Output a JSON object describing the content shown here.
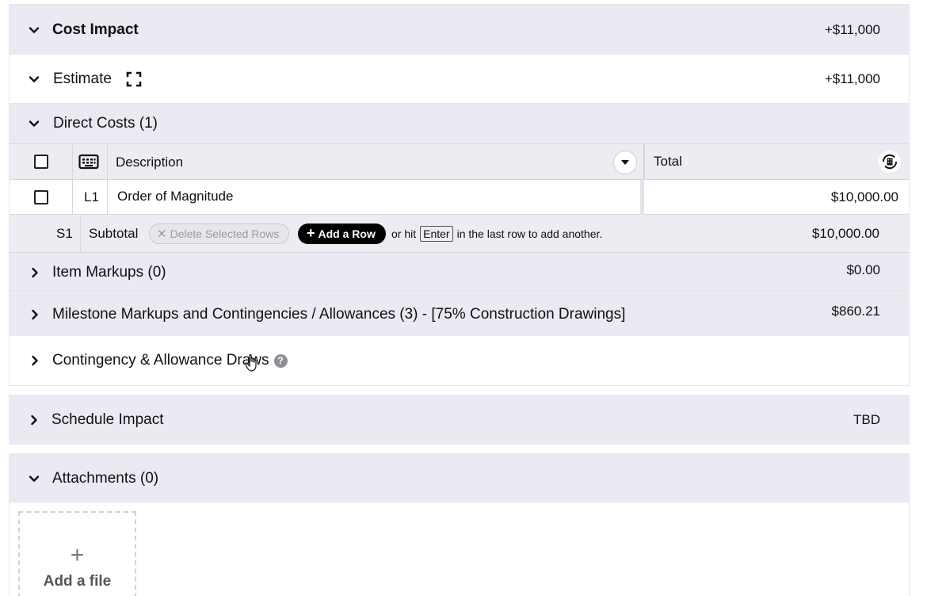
{
  "cost_impact": {
    "title": "Cost Impact",
    "amount": "+$11,000"
  },
  "estimate": {
    "title": "Estimate",
    "amount": "+$11,000"
  },
  "direct_costs": {
    "title": "Direct Costs (1)",
    "columns": {
      "description": "Description",
      "total": "Total"
    },
    "rows": [
      {
        "line": "L1",
        "description": "Order of Magnitude",
        "total": "$10,000.00"
      }
    ],
    "subtotal": {
      "code": "S1",
      "label": "Subtotal",
      "delete_label": "Delete Selected Rows",
      "add_label": "Add a Row",
      "hint_prefix": "or hit",
      "hint_key": "Enter",
      "hint_suffix": "in the last row to add another.",
      "amount": "$10,000.00"
    }
  },
  "item_markups": {
    "title": "Item Markups (0)",
    "amount": "$0.00"
  },
  "milestone_markups": {
    "title": "Milestone Markups and Contingencies / Allowances (3) - [75% Construction Drawings]",
    "amount": "$860.21"
  },
  "contingency_draws": {
    "title": "Contingency & Allowance Draws"
  },
  "schedule_impact": {
    "title": "Schedule Impact",
    "amount": "TBD"
  },
  "attachments": {
    "title": "Attachments (0)",
    "add_file_label": "Add a file"
  },
  "colors": {
    "header_bg": "#e9eaf2",
    "add_button_bg": "#000000",
    "border": "#d7d8df"
  }
}
